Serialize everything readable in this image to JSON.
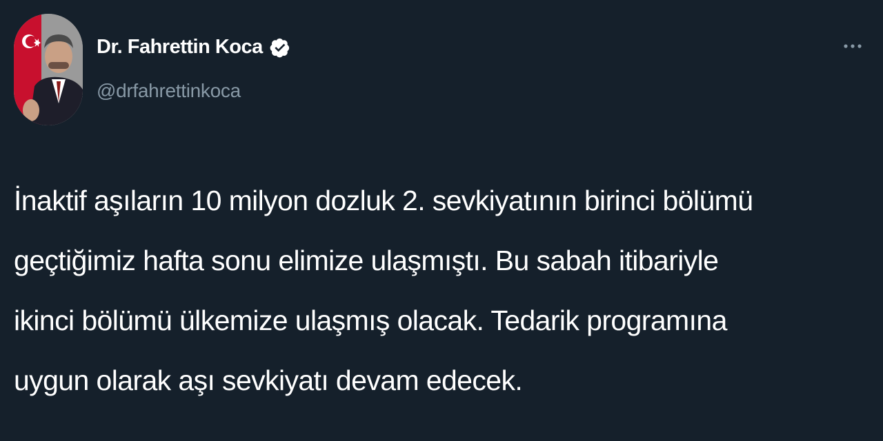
{
  "author": {
    "display_name": "Dr. Fahrettin Koca",
    "handle": "@drfahrettinkoca",
    "verified": true,
    "avatar_icon": "profile-photo"
  },
  "actions": {
    "more_icon": "more-options-icon"
  },
  "tweet": {
    "text": "İnaktif aşıların 10 milyon dozluk 2. sevkiyatının birinci bölümü\ngeçtiğimiz hafta sonu elimize ulaşmıştı. Bu sabah itibariyle\nikinci bölümü ülkemize ulaşmış olacak. Tedarik programına\nuygun olarak aşı sevkiyatı devam edecek."
  },
  "colors": {
    "background": "#15202b",
    "text_primary": "#ffffff",
    "text_secondary": "#8899a6",
    "verified_badge": "#ffffff"
  }
}
